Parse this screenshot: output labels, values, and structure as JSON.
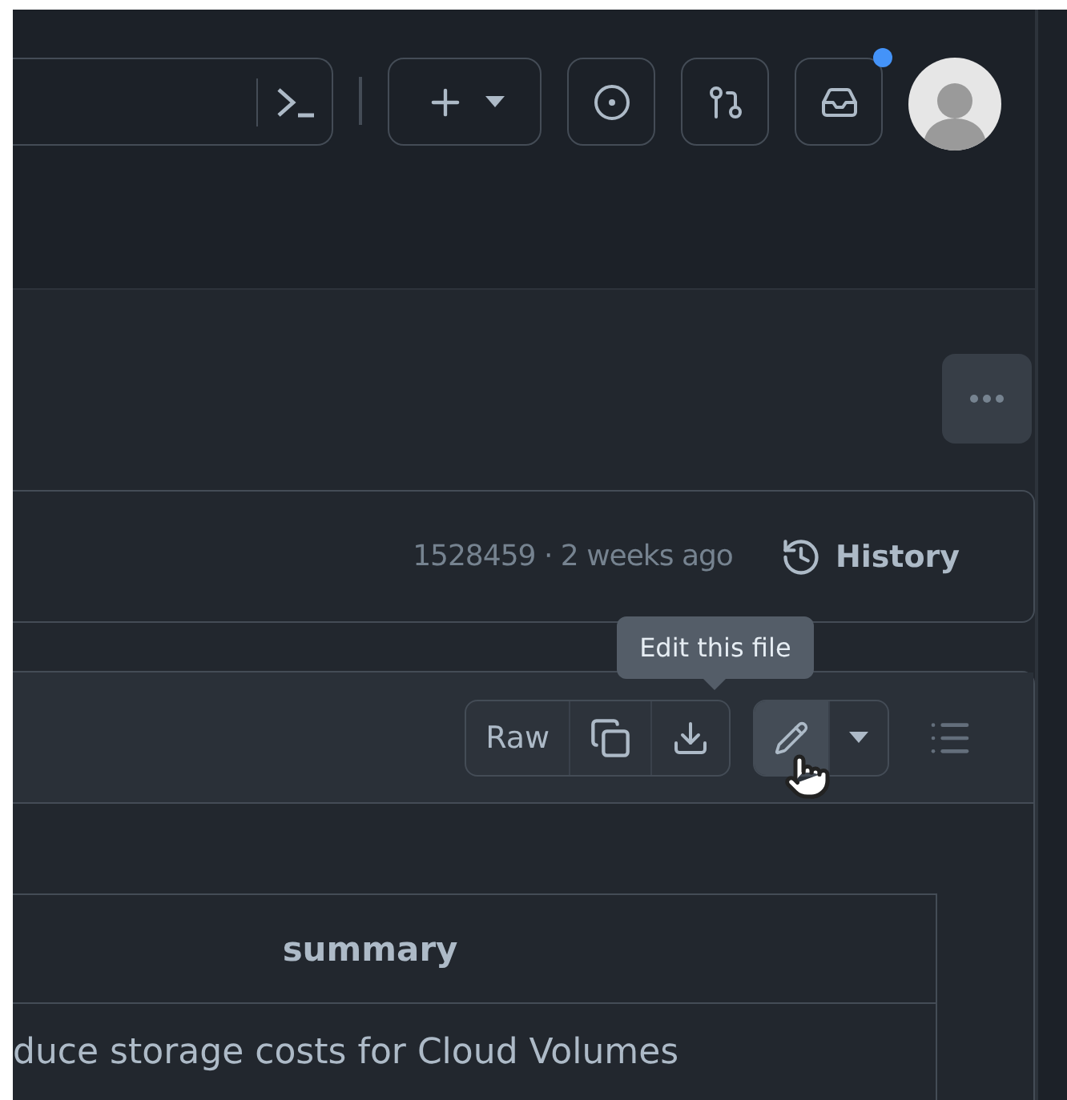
{
  "header": {
    "create_button": {
      "has_caret": true
    },
    "inbox": {
      "unread": true
    }
  },
  "commit_bar": {
    "commit": "1528459 · 2 weeks ago",
    "history": "History"
  },
  "file_toolbar": {
    "raw": "Raw",
    "edit_active": true,
    "tooltip": "Edit this file"
  },
  "table": {
    "columns": [
      "summary"
    ],
    "rows": [
      [
        "duce storage costs for Cloud Volumes"
      ]
    ]
  }
}
